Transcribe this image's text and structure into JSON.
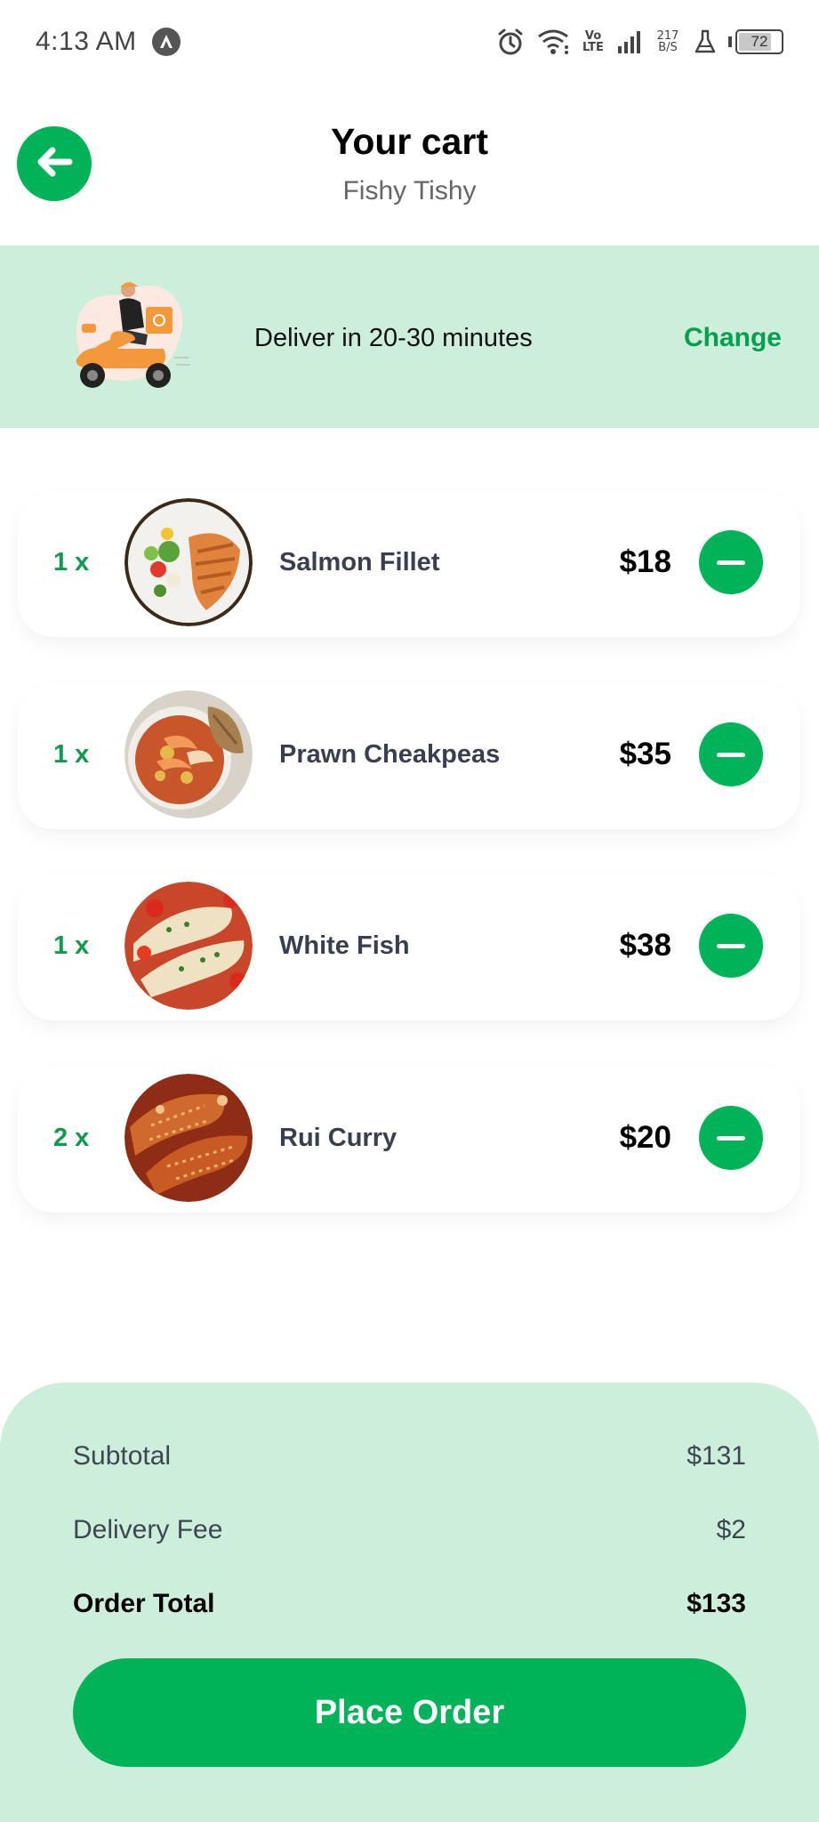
{
  "status_bar": {
    "time": "4:13 AM",
    "net_speed_value": "217",
    "net_speed_unit": "B/S",
    "volte_top": "Vo",
    "volte_bottom": "LTE",
    "battery": "72",
    "icons": [
      "app-notification-icon",
      "alarm-icon",
      "wifi-icon",
      "volte-icon",
      "signal-icon",
      "flask-icon",
      "battery-icon"
    ]
  },
  "header": {
    "back_icon": "arrow-left-icon",
    "title": "Your cart",
    "subtitle": "Fishy Tishy"
  },
  "delivery": {
    "illustration": "delivery-scooter-illustration",
    "text": "Deliver in 20-30 minutes",
    "change_label": "Change"
  },
  "cart": {
    "items": [
      {
        "qty": "1 x",
        "name": "Salmon Fillet",
        "price": "$18",
        "image": "salmon-fillet-photo"
      },
      {
        "qty": "1 x",
        "name": "Prawn Cheakpeas",
        "price": "$35",
        "image": "prawn-chickpeas-photo"
      },
      {
        "qty": "1 x",
        "name": "White Fish",
        "price": "$38",
        "image": "white-fish-photo"
      },
      {
        "qty": "2 x",
        "name": "Rui Curry",
        "price": "$20",
        "image": "rui-curry-photo"
      }
    ],
    "remove_icon": "minus-icon"
  },
  "summary": {
    "subtotal_label": "Subtotal",
    "subtotal_value": "$131",
    "delivery_fee_label": "Delivery Fee",
    "delivery_fee_value": "$2",
    "total_label": "Order Total",
    "total_value": "$133",
    "place_order_label": "Place Order"
  },
  "colors": {
    "accent": "#00b359",
    "accent_text": "#119a4f",
    "banner_bg": "#cdeedb",
    "price_text": "#000000",
    "item_name": "#3a3f4f"
  }
}
